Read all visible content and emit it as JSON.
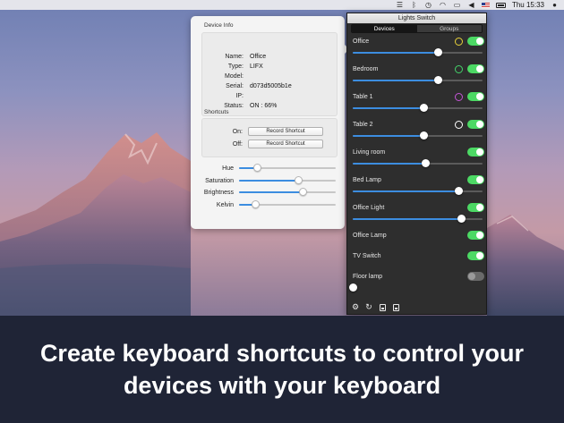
{
  "menubar": {
    "time": "Thu 15:33",
    "icons": [
      "lights-switch-icon",
      "bluetooth-icon",
      "time-machine-icon",
      "wifi-icon",
      "airplay-icon",
      "volume-icon",
      "us-flag-icon",
      "battery-icon",
      "user-icon"
    ]
  },
  "device_info": {
    "title": "Device Info",
    "fields": [
      {
        "key": "Name:",
        "value": "Office"
      },
      {
        "key": "Type:",
        "value": "LIFX"
      },
      {
        "key": "Model:",
        "value": ""
      },
      {
        "key": "Serial:",
        "value": "d073d5005b1e"
      },
      {
        "key": "IP:",
        "value": ""
      },
      {
        "key": "Status:",
        "value": "ON : 66%"
      }
    ],
    "shortcuts_title": "Shortcuts",
    "shortcuts": [
      {
        "key": "On:",
        "button": "Record Shortcut"
      },
      {
        "key": "Off:",
        "button": "Record Shortcut"
      }
    ],
    "sliders": [
      {
        "label": "Hue",
        "value": 0.19
      },
      {
        "label": "Saturation",
        "value": 0.62
      },
      {
        "label": "Brightness",
        "value": 0.66
      },
      {
        "label": "Kelvin",
        "value": 0.17
      }
    ]
  },
  "lights_switch": {
    "title": "Lights Switch",
    "tabs": [
      {
        "label": "Devices",
        "active": true
      },
      {
        "label": "Groups",
        "active": false
      }
    ],
    "devices": [
      {
        "name": "Office",
        "on": true,
        "color": "#e8d23a",
        "level": 0.66
      },
      {
        "name": "Bedroom",
        "on": true,
        "color": "#44d36a",
        "level": 0.66
      },
      {
        "name": "Table 1",
        "on": true,
        "color": "#c455d6",
        "level": 0.55
      },
      {
        "name": "Table 2",
        "on": true,
        "color": "#ffffff",
        "level": 0.55
      },
      {
        "name": "Living room",
        "on": true,
        "color": null,
        "level": 0.56
      },
      {
        "name": "Bed Lamp",
        "on": true,
        "color": null,
        "level": 0.82
      },
      {
        "name": "Office Light",
        "on": true,
        "color": null,
        "level": 0.84
      },
      {
        "name": "Office Lamp",
        "on": true,
        "color": null,
        "level": null
      },
      {
        "name": "TV Switch",
        "on": true,
        "color": null,
        "level": null
      },
      {
        "name": "Floor lamp",
        "on": false,
        "color": null,
        "level": 0.0
      }
    ],
    "footer_icons": [
      "gear-icon",
      "refresh-icon",
      "document-icon",
      "preset-icon"
    ]
  },
  "caption": {
    "text": "Create keyboard shortcuts to control your devices with your keyboard"
  },
  "colors": {
    "accent_blue": "#3c8de0",
    "toggle_green": "#4cd964",
    "caption_bg": "#1f2436",
    "panel_dark": "#2e2e2e"
  }
}
